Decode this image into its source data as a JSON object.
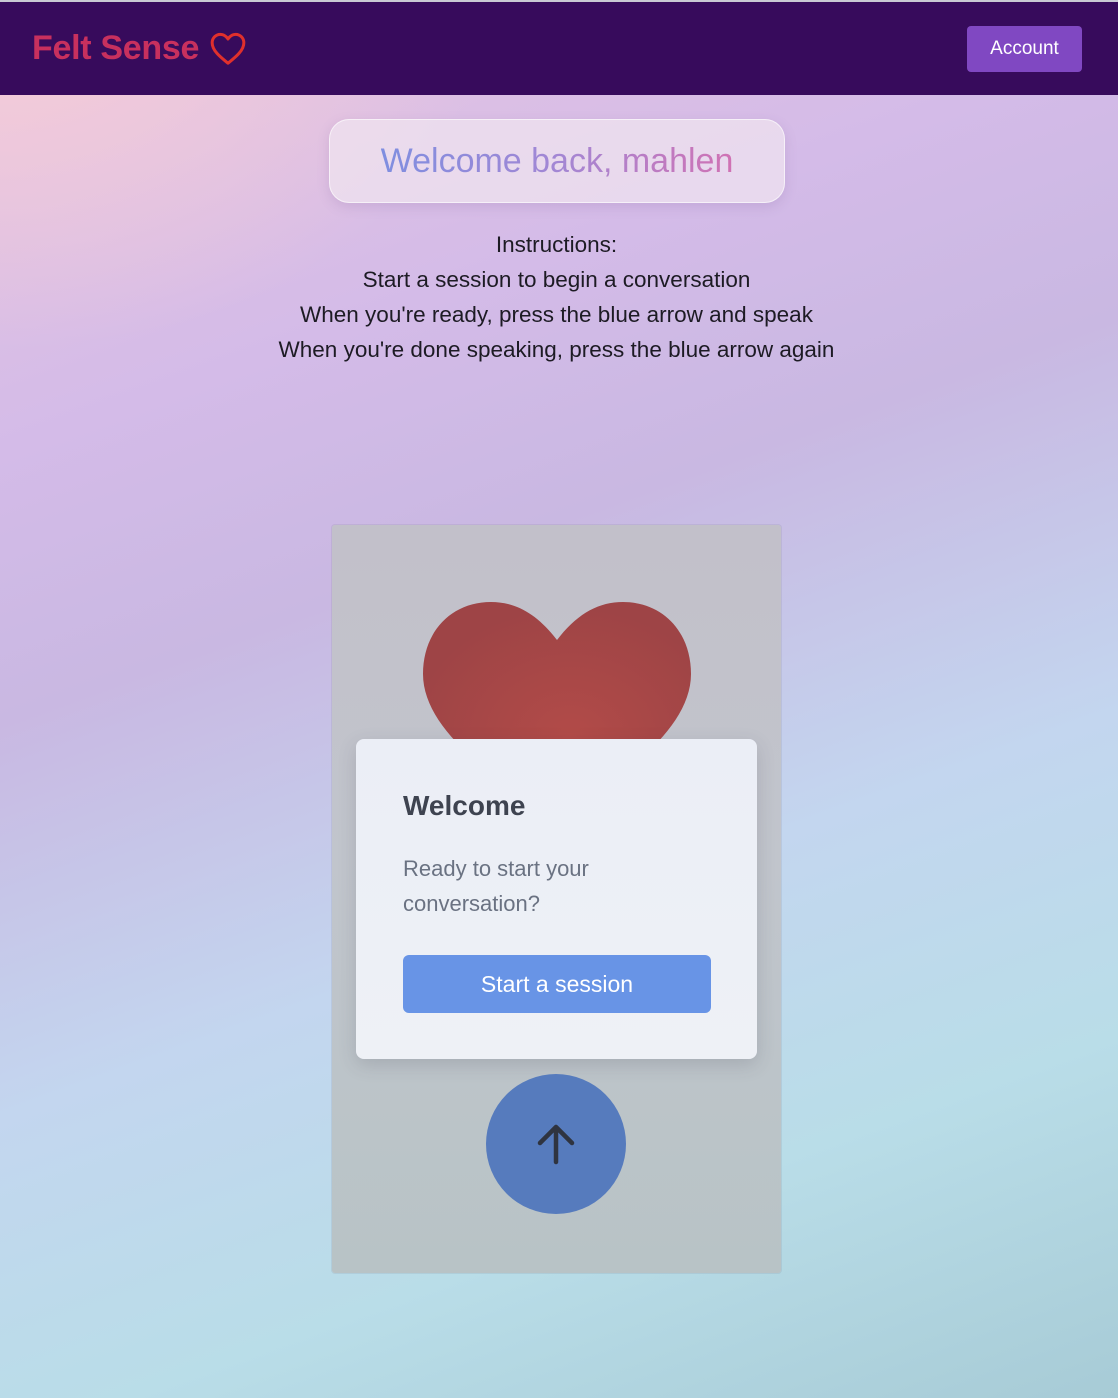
{
  "navbar": {
    "brand": "Felt Sense",
    "brand_icon": "heart-outline-icon",
    "account_label": "Account",
    "colors": {
      "background": "#370b5c",
      "brand_text": "#c8305e",
      "brand_icon": "#e0302c",
      "account_button": "#8048c2"
    }
  },
  "greeting": {
    "text": "Welcome back, mahlen"
  },
  "instructions": {
    "lines": [
      "Instructions:",
      "Start a session to begin a conversation",
      "When you're ready, press the blue arrow and speak",
      "When you're done speaking, press the blue arrow again"
    ]
  },
  "session_panel": {
    "hero_icon": "heart-icon",
    "card": {
      "title": "Welcome",
      "subtitle": "Ready to start your conversation?",
      "start_label": "Start a session"
    },
    "mic_button_icon": "arrow-up-icon",
    "colors": {
      "heart": "#a84545",
      "start_button": "#6894e6",
      "arrow_button": "#567bbd"
    }
  }
}
